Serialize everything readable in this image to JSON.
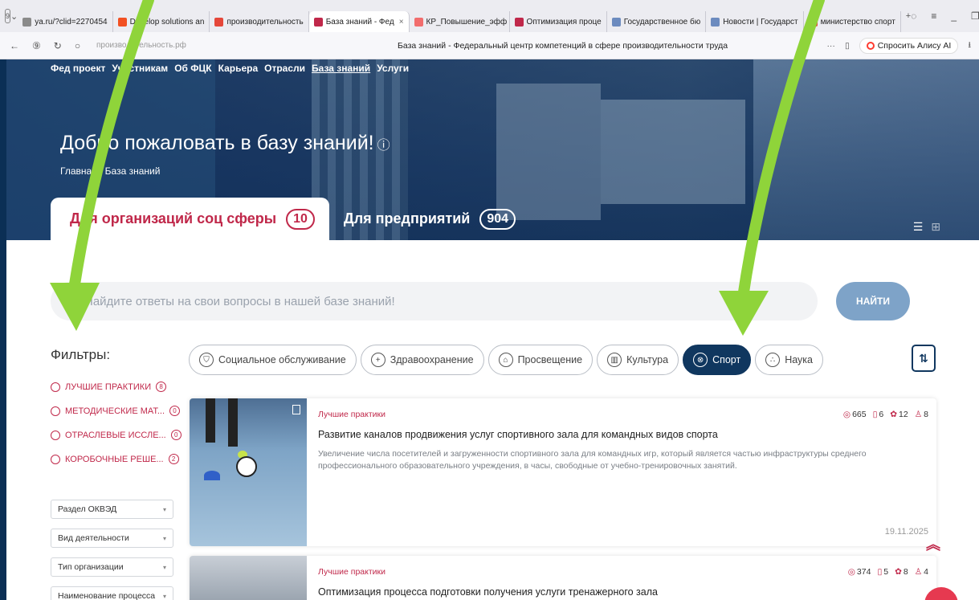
{
  "browser": {
    "tabs": [
      {
        "label": "ya.ru/?clid=2270454",
        "fav": "#8a8a8a",
        "active": false
      },
      {
        "label": "Develop solutions an",
        "fav": "#f25022",
        "active": false
      },
      {
        "label": "производительность",
        "fav": "#e5473a",
        "active": false
      },
      {
        "label": "База знаний - Фед",
        "fav": "#c0284a",
        "active": true
      },
      {
        "label": "КР_Повышение_эфф",
        "fav": "#f26d6d",
        "active": false
      },
      {
        "label": "Оптимизация проце",
        "fav": "#c0284a",
        "active": false
      },
      {
        "label": "Государственное бю",
        "fav": "#6c8bbf",
        "active": false
      },
      {
        "label": "Новости | Государст",
        "fav": "#6c8bbf",
        "active": false
      },
      {
        "label": "министерство спорт",
        "fav": "#e5473a",
        "active": false
      }
    ],
    "tab_counter": "9",
    "url": "производительность.рф",
    "page_title": "База знаний - Федеральный центр компетенций в сфере производительности труда",
    "alice_label": "Спросить Алису AI"
  },
  "hero": {
    "nav": [
      "Фед проект",
      "Участникам",
      "Об ФЦК",
      "Карьера",
      "Отрасли",
      "База знаний",
      "Услуги"
    ],
    "title": "Добро пожаловать в базу знаний!",
    "info_icon": "ⓘ",
    "breadcrumb": "Главная / База знаний",
    "tab_social": {
      "label": "Для организаций соц сферы",
      "count": "10"
    },
    "tab_enterprise": {
      "label": "Для предприятий",
      "count": "904"
    }
  },
  "search": {
    "placeholder": "Найдите ответы на свои вопросы в нашей базе знаний!",
    "button": "НАЙТИ"
  },
  "filters": {
    "title": "Фильтры:",
    "items": [
      {
        "label": "ЛУЧШИЕ ПРАКТИКИ",
        "count": "8"
      },
      {
        "label": "МЕТОДИЧЕСКИЕ МАТ...",
        "count": "0"
      },
      {
        "label": "ОТРАСЛЕВЫЕ ИССЛЕ...",
        "count": "0"
      },
      {
        "label": "КОРОБОЧНЫЕ РЕШЕ...",
        "count": "2"
      }
    ],
    "selects": [
      "Раздел ОКВЭД",
      "Вид деятельности",
      "Тип организации",
      "Наименование процесса"
    ]
  },
  "categories": [
    {
      "label": "Социальное обслуживание",
      "icon": "shield-icon",
      "glyph": "⛉",
      "active": false
    },
    {
      "label": "Здравоохранение",
      "icon": "medical-cross-icon",
      "glyph": "+",
      "active": false
    },
    {
      "label": "Просвещение",
      "icon": "graduation-cap-icon",
      "glyph": "⌂",
      "active": false
    },
    {
      "label": "Культура",
      "icon": "museum-icon",
      "glyph": "▥",
      "active": false
    },
    {
      "label": "Спорт",
      "icon": "ball-icon",
      "glyph": "⊗",
      "active": true
    },
    {
      "label": "Наука",
      "icon": "molecule-icon",
      "glyph": "∴",
      "active": false
    }
  ],
  "cards": [
    {
      "type": "Лучшие практики",
      "title": "Развитие каналов продвижения услуг спортивного зала для командных видов спорта",
      "desc": "Увеличение числа посетителей и загруженности спортивного зала для командных игр, который является частью инфраструктуры среднего профессионального образовательного учреждения, в часы, свободные от учебно-тренировочных занятий.",
      "views": "665",
      "bookmarks": "6",
      "rating": "12",
      "likes": "8",
      "date": "19.11.2025"
    },
    {
      "type": "Лучшие практики",
      "title": "Оптимизация процесса подготовки получения услуги тренажерного зала",
      "desc": "",
      "views": "374",
      "bookmarks": "5",
      "rating": "8",
      "likes": "4",
      "date": ""
    }
  ],
  "colors": {
    "accent": "#c0284a",
    "navy": "#10375f",
    "arrow": "#8fd43a"
  }
}
